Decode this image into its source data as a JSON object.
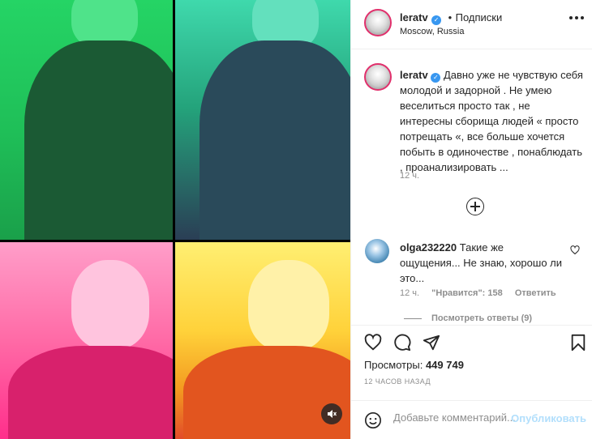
{
  "post": {
    "username": "leratv",
    "follow_separator": "•",
    "follow_label": "Подписки",
    "location": "Moscow, Russia"
  },
  "caption": {
    "username": "leratv",
    "text": "Давно уже не чувствую себя молодой и задорной . Не умею веселиться просто так , не интересны сборища людей « просто потрещать «, все больше хочется побыть в одиночестве , понаблюдать , проанализировать ...",
    "time": "12 ч."
  },
  "comment": {
    "username": "olga232220",
    "text": "Такие же ощущения... Не знаю, хорошо ли это...",
    "time": "12 ч.",
    "likes": "\"Нравится\": 158",
    "reply_label": "Ответить",
    "view_replies": "Посмотреть ответы (9)"
  },
  "stats": {
    "views_label": "Просмотры:",
    "views_value": "449 749",
    "posted_ago": "12 ЧАСОВ НАЗАД"
  },
  "add_comment": {
    "placeholder": "Добавьте комментарий...",
    "publish_label": "Опубликовать"
  },
  "icons": {
    "verified": "verified-badge-icon",
    "more": "more-options-icon",
    "load_more": "plus-circle-icon",
    "like": "heart-icon",
    "comment": "comment-bubble-icon",
    "share": "paper-plane-icon",
    "save": "bookmark-icon",
    "emoji": "smiley-icon",
    "mute": "sound-off-icon"
  },
  "colors": {
    "panel_top_left": "#25d465",
    "panel_top_right": "#2fbf94",
    "panel_bottom_left": "#ff5fa2",
    "panel_bottom_right": "#ffd23a",
    "link_blue": "#3897f0",
    "publish_disabled": "#b2dffc"
  }
}
